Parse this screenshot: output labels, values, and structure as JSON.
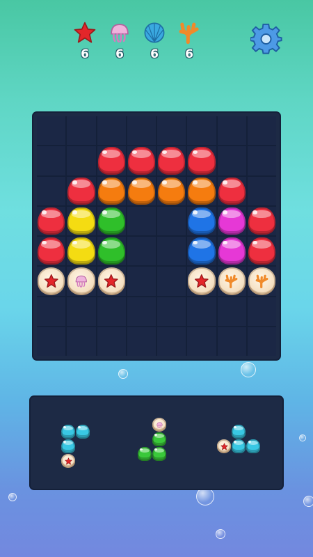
{
  "goals": [
    {
      "icon": "starfish-icon",
      "count": "6",
      "color": "#e3262a"
    },
    {
      "icon": "jellyfish-icon",
      "count": "6",
      "color": "#e9a6d4"
    },
    {
      "icon": "shell-icon",
      "count": "6",
      "color": "#3aa9e0"
    },
    {
      "icon": "coral-icon",
      "count": "6",
      "color": "#f08a2a"
    }
  ],
  "settings_icon": "gear-icon",
  "colors": {
    "R": "#ee2f3f",
    "O": "#f57c0f",
    "Y": "#f4dc12",
    "G": "#2fbf2a",
    "B": "#1f74e6",
    "M": "#e638d6",
    "C": "#39c8e4",
    "g": "#3ac83a"
  },
  "board": {
    "rows": [
      [
        ".",
        ".",
        ".",
        ".",
        ".",
        ".",
        ".",
        "."
      ],
      [
        ".",
        ".",
        "R",
        "R",
        "R",
        "R",
        ".",
        "."
      ],
      [
        ".",
        "R",
        "O",
        "O",
        "O",
        "O",
        "R",
        "."
      ],
      [
        "R",
        "Y",
        "G",
        ".",
        ".",
        "B",
        "M",
        "R"
      ],
      [
        "R",
        "Y",
        "G",
        ".",
        ".",
        "B",
        "M",
        "R"
      ],
      [
        "*s",
        "*s",
        "*s",
        ".",
        ".",
        "*s",
        "*s",
        "*s"
      ],
      [
        ".",
        ".",
        ".",
        ".",
        ".",
        ".",
        ".",
        "."
      ],
      [
        ".",
        ".",
        ".",
        ".",
        ".",
        ".",
        ".",
        "."
      ]
    ],
    "tiles": [
      [
        5,
        0,
        "starfish"
      ],
      [
        5,
        1,
        "jellyfish"
      ],
      [
        5,
        2,
        "starfish"
      ],
      [
        5,
        5,
        "starfish"
      ],
      [
        5,
        6,
        "coral"
      ],
      [
        5,
        7,
        "coral"
      ]
    ]
  },
  "tray": {
    "pieces": [
      {
        "name": "piece-1",
        "cells": [
          [
            0,
            0,
            "C"
          ],
          [
            0,
            1,
            "C"
          ],
          [
            1,
            0,
            "C"
          ],
          [
            2,
            0,
            "starfish"
          ]
        ]
      },
      {
        "name": "piece-2",
        "cells": [
          [
            0,
            1,
            "jellyfish"
          ],
          [
            1,
            1,
            "g"
          ],
          [
            2,
            0,
            "g"
          ],
          [
            2,
            1,
            "g"
          ]
        ]
      },
      {
        "name": "piece-3",
        "cells": [
          [
            0,
            1,
            "C"
          ],
          [
            1,
            0,
            "starfish"
          ],
          [
            1,
            1,
            "C"
          ],
          [
            1,
            2,
            "C"
          ]
        ]
      }
    ]
  }
}
